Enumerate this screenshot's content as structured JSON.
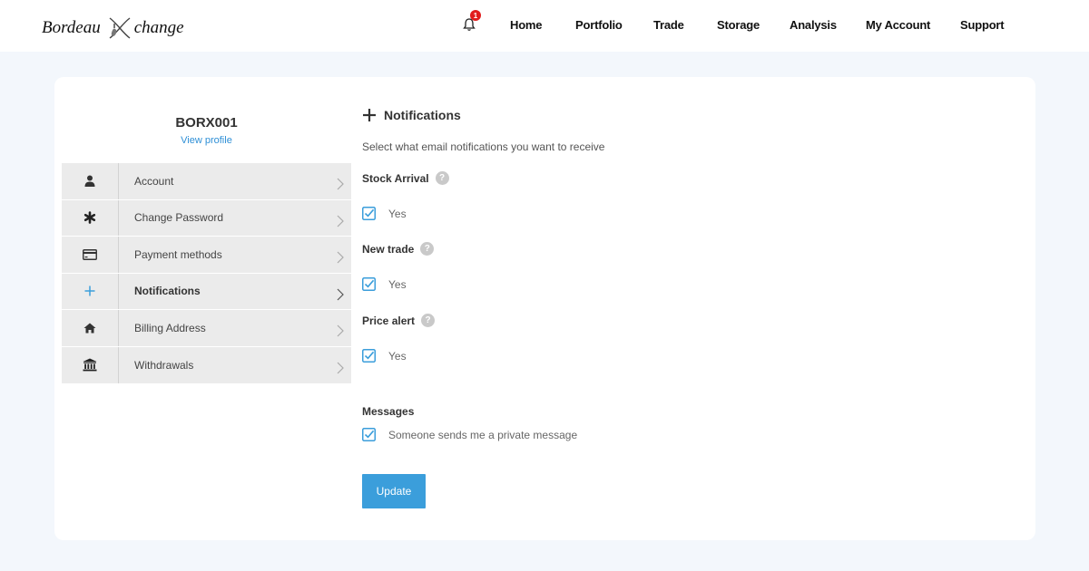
{
  "header": {
    "logo_left": "Bordeau",
    "logo_right": "change",
    "notification_count": "1",
    "nav": [
      {
        "label": "Home"
      },
      {
        "label": "Portfolio"
      },
      {
        "label": "Trade"
      },
      {
        "label": "Storage"
      },
      {
        "label": "Analysis"
      },
      {
        "label": "My Account"
      },
      {
        "label": "Support"
      }
    ]
  },
  "profile": {
    "id": "BORX001",
    "link": "View profile"
  },
  "sidebar": {
    "items": [
      {
        "label": "Account",
        "icon": "user-icon"
      },
      {
        "label": "Change Password",
        "icon": "asterisk-icon"
      },
      {
        "label": "Payment methods",
        "icon": "credit-card-icon"
      },
      {
        "label": "Notifications",
        "icon": "plus-icon",
        "active": true
      },
      {
        "label": "Billing Address",
        "icon": "home-icon"
      },
      {
        "label": "Withdrawals",
        "icon": "bank-icon"
      }
    ]
  },
  "main": {
    "title": "Notifications",
    "subtitle": "Select what email notifications you want to receive",
    "groups": [
      {
        "label": "Stock Arrival",
        "help": "?",
        "option": "Yes",
        "checked": true
      },
      {
        "label": "New trade",
        "help": "?",
        "option": "Yes",
        "checked": true
      },
      {
        "label": "Price alert",
        "help": "?",
        "option": "Yes",
        "checked": true
      }
    ],
    "messages": {
      "label": "Messages",
      "option": "Someone sends me a private message",
      "checked": true
    },
    "update_label": "Update"
  },
  "colors": {
    "accent": "#3b9edb",
    "badge": "#e11d1d",
    "background": "#f3f7fc",
    "sidebar": "#ebebeb"
  }
}
